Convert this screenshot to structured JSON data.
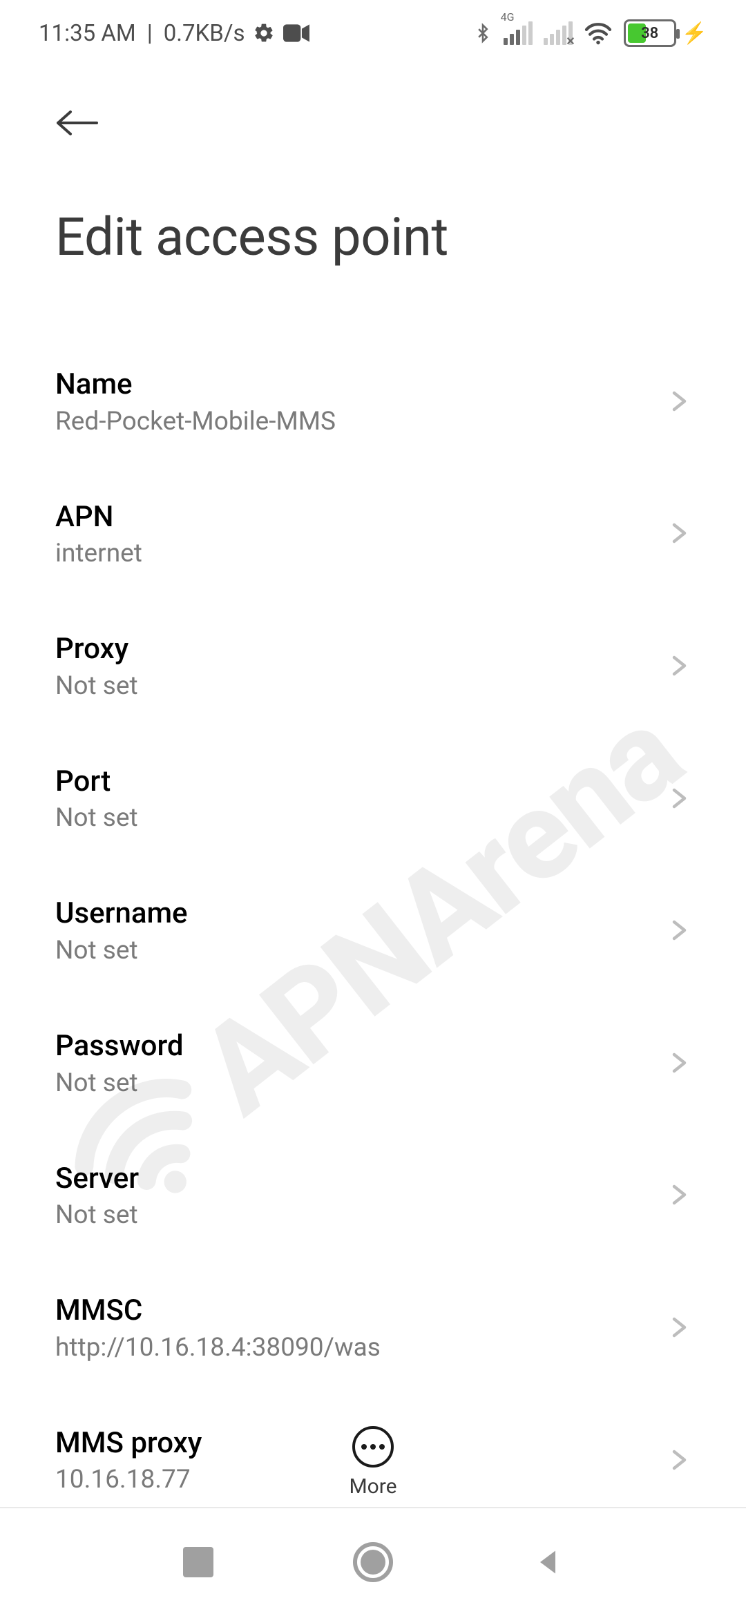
{
  "status": {
    "time": "11:35 AM",
    "data_rate": "0.7KB/s",
    "network_tag": "4G",
    "battery_percent": "38"
  },
  "header": {
    "title": "Edit access point"
  },
  "fields": [
    {
      "label": "Name",
      "value": "Red-Pocket-Mobile-MMS"
    },
    {
      "label": "APN",
      "value": "internet"
    },
    {
      "label": "Proxy",
      "value": "Not set"
    },
    {
      "label": "Port",
      "value": "Not set"
    },
    {
      "label": "Username",
      "value": "Not set"
    },
    {
      "label": "Password",
      "value": "Not set"
    },
    {
      "label": "Server",
      "value": "Not set"
    },
    {
      "label": "MMSC",
      "value": "http://10.16.18.4:38090/was"
    },
    {
      "label": "MMS proxy",
      "value": "10.16.18.77"
    }
  ],
  "bottom": {
    "more_label": "More"
  },
  "watermark": {
    "text": "APNArena"
  }
}
